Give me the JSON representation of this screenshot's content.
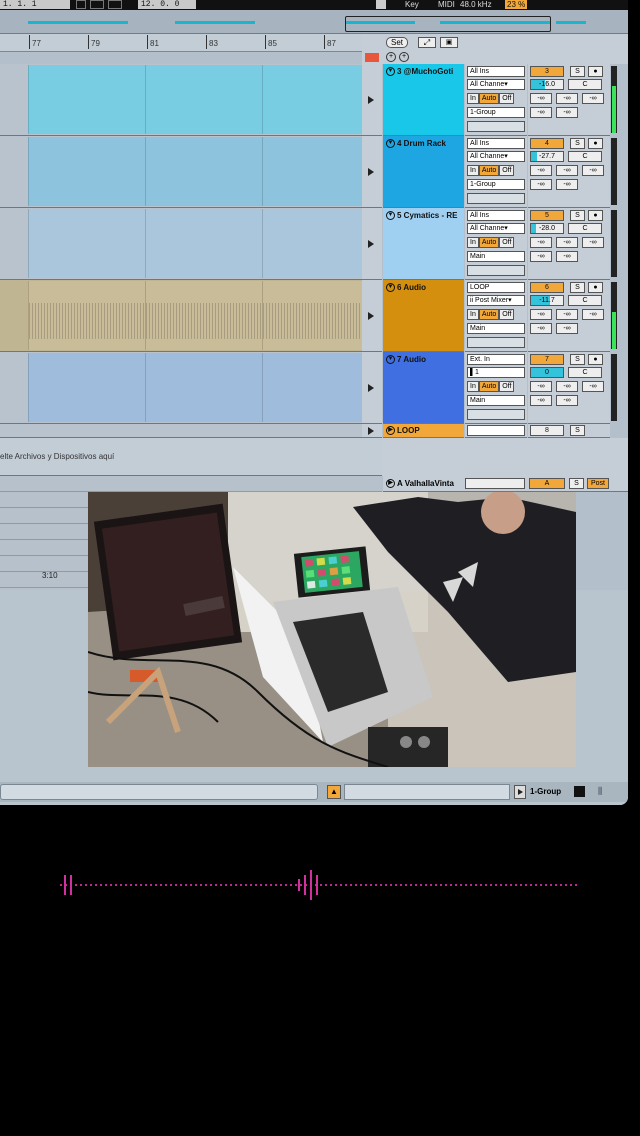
{
  "topbar": {
    "position": "1.  1.  1",
    "tempo_readout": "12.  0.  0",
    "key_label": "Key",
    "midi_label": "MIDI",
    "sample_rate": "48.0 kHz",
    "cpu": "23 %"
  },
  "ruler": {
    "bars": [
      "77",
      "79",
      "81",
      "83",
      "85",
      "87"
    ]
  },
  "session_controls": {
    "set_label": "Set"
  },
  "tracks": [
    {
      "name": "3 @MuchoGoti",
      "color": "#19c7e8",
      "input_type": "All Ins",
      "input_channel": "All Channe▾",
      "monitor": [
        "In",
        "Auto",
        "Off"
      ],
      "output": "1-Group",
      "number": "3",
      "volume": "-16.0",
      "volume_fill": 0.45,
      "pan": "C",
      "sends": [
        "-∞",
        "-∞",
        "-∞"
      ],
      "send_row2": [
        "-∞",
        "-∞"
      ],
      "clip_color": "#79cde3",
      "meter_level": 0.7
    },
    {
      "name": "4 Drum Rack",
      "color": "#1ea6e3",
      "input_type": "All Ins",
      "input_channel": "All Channe▾",
      "monitor": [
        "In",
        "Auto",
        "Off"
      ],
      "output": "1-Group",
      "number": "4",
      "volume": "-27.7",
      "volume_fill": 0.18,
      "pan": "C",
      "sends": [
        "-∞",
        "-∞",
        "-∞"
      ],
      "send_row2": [
        "-∞",
        "-∞"
      ],
      "clip_color": "#8ec3dd",
      "meter_level": 0
    },
    {
      "name": "5 Cymatics - RE",
      "color": "#9fd0f2",
      "input_type": "All Ins",
      "input_channel": "All Channe▾",
      "monitor": [
        "In",
        "Auto",
        "Off"
      ],
      "output": "Main",
      "number": "5",
      "volume": "-28.0",
      "volume_fill": 0.17,
      "pan": "C",
      "sends": [
        "-∞",
        "-∞",
        "-∞"
      ],
      "send_row2": [
        "-∞",
        "-∞"
      ],
      "clip_color": "#a9c6dc",
      "meter_level": 0
    },
    {
      "name": "6 Audio",
      "color": "#d48f0f",
      "input_type": "LOOP",
      "input_channel": "ii Post Mixer▾",
      "monitor": [
        "In",
        "Auto",
        "Off"
      ],
      "output": "Main",
      "number": "6",
      "volume": "-11.7",
      "volume_fill": 0.6,
      "pan": "C",
      "sends": [
        "-∞",
        "-∞",
        "-∞"
      ],
      "send_row2": [
        "-∞",
        "-∞"
      ],
      "clip_color": "#c9bc98",
      "meter_level": 0.55
    },
    {
      "name": "7 Audio",
      "color": "#3f6fe0",
      "input_type": "Ext. In",
      "input_channel": "▌1",
      "monitor": [
        "In",
        "Auto",
        "Off"
      ],
      "output": "Main",
      "number": "7",
      "volume": "0",
      "volume_fill": 1.0,
      "pan": "C",
      "sends": [
        "-∞",
        "-∞",
        "-∞"
      ],
      "send_row2": [
        "-∞",
        "-∞"
      ],
      "clip_color": "#9fbcdd",
      "meter_level": 0
    }
  ],
  "loop_track": {
    "name": "LOOP",
    "color": "#f2a73b",
    "number": "8",
    "solo": "S"
  },
  "return_track": {
    "name": "A ValhallaVinta",
    "solo_label": "A",
    "post_label": "Post"
  },
  "drop_area": {
    "text": "elte Archivos y Dispositivos aquí"
  },
  "return_lane": {
    "time_label": "3:10"
  },
  "status_bar": {
    "group_label": "1-Group"
  },
  "buttons": {
    "solo": "S"
  }
}
